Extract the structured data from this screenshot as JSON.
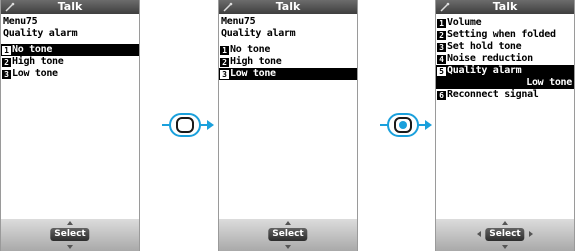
{
  "colors": {
    "selection": "#000000",
    "arrow": "#1aa0dc",
    "softbar": "#c4c4c4"
  },
  "screens": [
    {
      "title": "Talk",
      "header": [
        "Menu75",
        "Quality alarm"
      ],
      "items": [
        {
          "num": "1",
          "label": "No tone",
          "selected": true
        },
        {
          "num": "2",
          "label": "High tone",
          "selected": false
        },
        {
          "num": "3",
          "label": "Low tone",
          "selected": false
        }
      ],
      "softkey": "Select",
      "softkey_icon": "dpad-up-down-icon"
    },
    {
      "title": "Talk",
      "header": [
        "Menu75",
        "Quality alarm"
      ],
      "items": [
        {
          "num": "1",
          "label": "No tone",
          "selected": false
        },
        {
          "num": "2",
          "label": "High tone",
          "selected": false
        },
        {
          "num": "3",
          "label": "Low tone",
          "selected": true
        }
      ],
      "softkey": "Select",
      "softkey_icon": "dpad-up-down-icon"
    },
    {
      "title": "Talk",
      "items": [
        {
          "num": "1",
          "label": "Volume"
        },
        {
          "num": "2",
          "label": "Setting when folded"
        },
        {
          "num": "3",
          "label": "Set hold tone"
        },
        {
          "num": "4",
          "label": "Noise reduction"
        },
        {
          "num": "5",
          "label": "Quality alarm"
        },
        {
          "sub": "Low tone"
        },
        {
          "num": "6",
          "label": "Reconnect signal"
        }
      ],
      "selected_rows": [
        4,
        5
      ],
      "softkey": "Select",
      "softkey_icon": "dpad-four-way-icon"
    }
  ],
  "navigation": [
    "center-key-press-icon",
    "center-key-press-icon"
  ]
}
